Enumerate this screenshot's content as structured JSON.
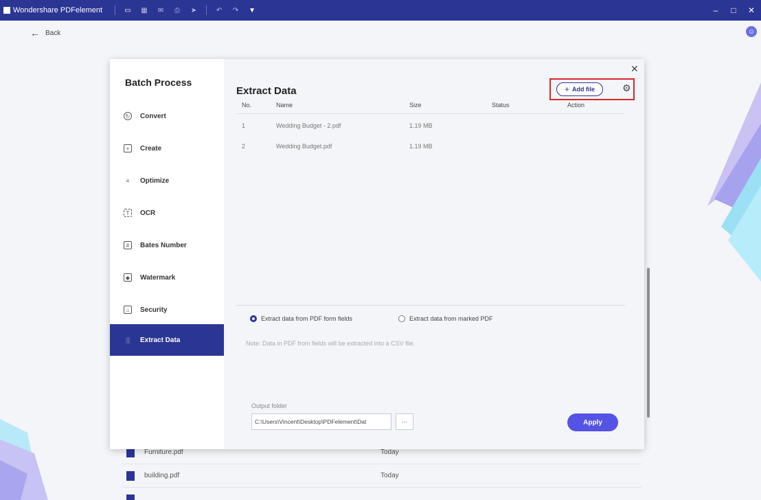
{
  "titlebar": {
    "app_name": "Wondershare PDFelement",
    "icons": [
      "folder-icon",
      "save-icon",
      "mail-icon",
      "print-icon",
      "share-icon",
      "undo-icon",
      "redo-icon",
      "customize-icon"
    ]
  },
  "nav": {
    "back_label": "Back"
  },
  "dialog": {
    "sidebar": {
      "title": "Batch Process",
      "items": [
        {
          "label": "Convert",
          "icon": "convert-icon"
        },
        {
          "label": "Create",
          "icon": "create-icon"
        },
        {
          "label": "Optimize",
          "icon": "optimize-icon"
        },
        {
          "label": "OCR",
          "icon": "ocr-icon"
        },
        {
          "label": "Bates Number",
          "icon": "bates-number-icon"
        },
        {
          "label": "Watermark",
          "icon": "watermark-icon"
        },
        {
          "label": "Security",
          "icon": "lock-icon"
        },
        {
          "label": "Extract Data",
          "icon": "bar-chart-icon",
          "active": true
        }
      ]
    },
    "main": {
      "title": "Extract Data",
      "add_file_label": "Add file",
      "table": {
        "headers": {
          "no": "No.",
          "name": "Name",
          "size": "Size",
          "status": "Status",
          "action": "Action"
        },
        "rows": [
          {
            "no": "1",
            "name": "Wedding Budget - 2.pdf",
            "size": "1.19 MB",
            "status": "",
            "action": ""
          },
          {
            "no": "2",
            "name": "Wedding Budget.pdf",
            "size": "1.19 MB",
            "status": "",
            "action": ""
          }
        ]
      },
      "options": {
        "form_fields_label": "Extract data from PDF form fields",
        "marked_pdf_label": "Extract data from marked PDF",
        "selected": "form_fields"
      },
      "note": "Note: Data in PDF from fields will be extracted into a CSV file.",
      "output": {
        "label": "Output folder",
        "path": "C:\\Users\\Vincent\\Desktop\\PDFelement\\Dat",
        "browse_label": "···"
      },
      "apply_label": "Apply"
    }
  },
  "background_files": [
    {
      "name": "Furniture.pdf",
      "date": "Today"
    },
    {
      "name": "building.pdf",
      "date": "Today"
    }
  ],
  "colors": {
    "titlebar": "#2b3594",
    "accent": "#2b3594",
    "apply": "#5553e6",
    "highlight_box": "#d9252a"
  }
}
